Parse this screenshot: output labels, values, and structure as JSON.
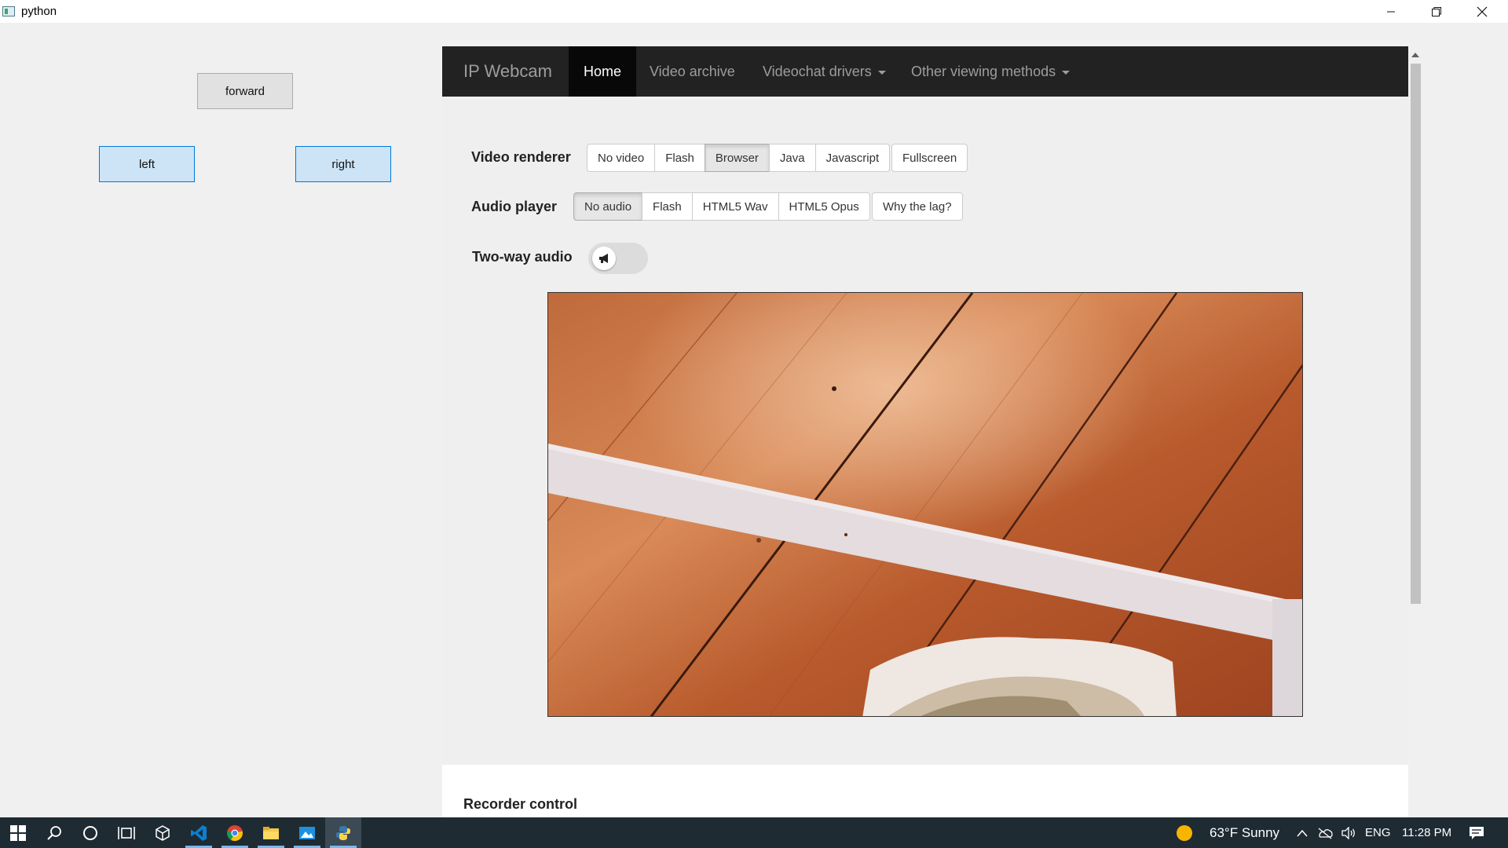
{
  "window": {
    "title": "python"
  },
  "controls": {
    "forward": "forward",
    "left": "left",
    "right": "right"
  },
  "webcam": {
    "brand": "IP Webcam",
    "nav": [
      {
        "label": "Home",
        "active": true
      },
      {
        "label": "Video archive"
      },
      {
        "label": "Videochat drivers",
        "dropdown": true
      },
      {
        "label": "Other viewing methods",
        "dropdown": true
      }
    ],
    "video_renderer": {
      "label": "Video renderer",
      "options": [
        "No video",
        "Flash",
        "Browser",
        "Java",
        "Javascript"
      ],
      "selected": "Browser",
      "extra": "Fullscreen"
    },
    "audio_player": {
      "label": "Audio player",
      "options": [
        "No audio",
        "Flash",
        "HTML5 Wav",
        "HTML5 Opus"
      ],
      "selected": "No audio",
      "extra": "Why the lag?"
    },
    "two_way_audio": {
      "label": "Two-way audio",
      "enabled": false,
      "icon": "megaphone-icon"
    },
    "recorder": {
      "title": "Recorder control"
    }
  },
  "taskbar": {
    "pinned": [
      "windows-start-icon",
      "search-icon",
      "cortana-icon",
      "task-view-icon",
      "3d-viewer-icon",
      "vscode-icon",
      "chrome-icon",
      "file-explorer-icon",
      "photos-icon",
      "python-icon"
    ],
    "weather": "63°F  Sunny",
    "language": "ENG",
    "time": "11:28 PM"
  }
}
